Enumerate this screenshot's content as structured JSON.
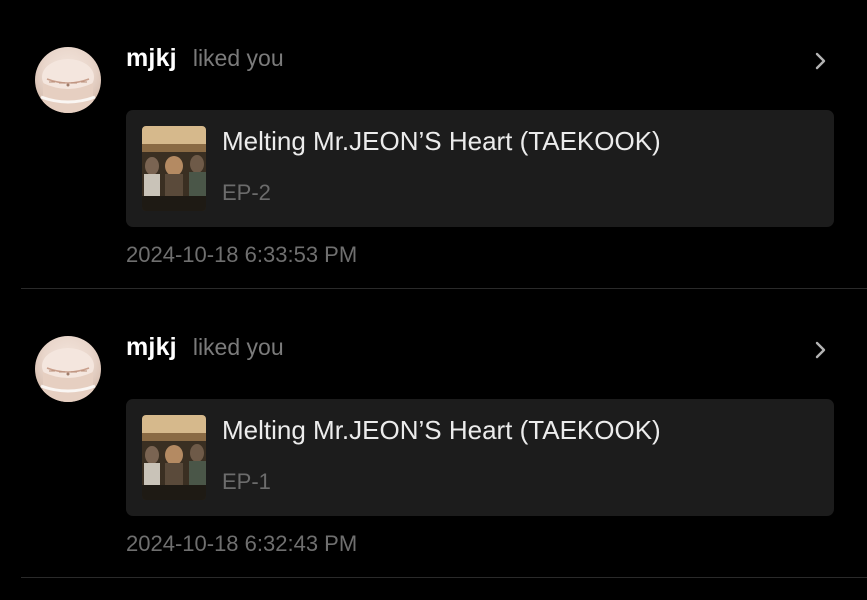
{
  "notifications": [
    {
      "username": "mjkj",
      "action": "liked you",
      "avatar_icon": "avatar-photo",
      "chevron_icon": "chevron-right-icon",
      "story": {
        "title": "Melting Mr.JEON’S Heart (TAEKOOK)",
        "episode": "EP-2"
      },
      "timestamp": "2024-10-18 6:33:53 PM"
    },
    {
      "username": "mjkj",
      "action": "liked you",
      "avatar_icon": "avatar-photo",
      "chevron_icon": "chevron-right-icon",
      "story": {
        "title": "Melting Mr.JEON’S Heart (TAEKOOK)",
        "episode": "EP-1"
      },
      "timestamp": "2024-10-18 6:32:43 PM"
    }
  ],
  "colors": {
    "background": "#000000",
    "card": "#1c1c1c",
    "primary_text": "#ffffff",
    "secondary_text": "#7b7b7b",
    "divider": "#2a2a2a"
  }
}
